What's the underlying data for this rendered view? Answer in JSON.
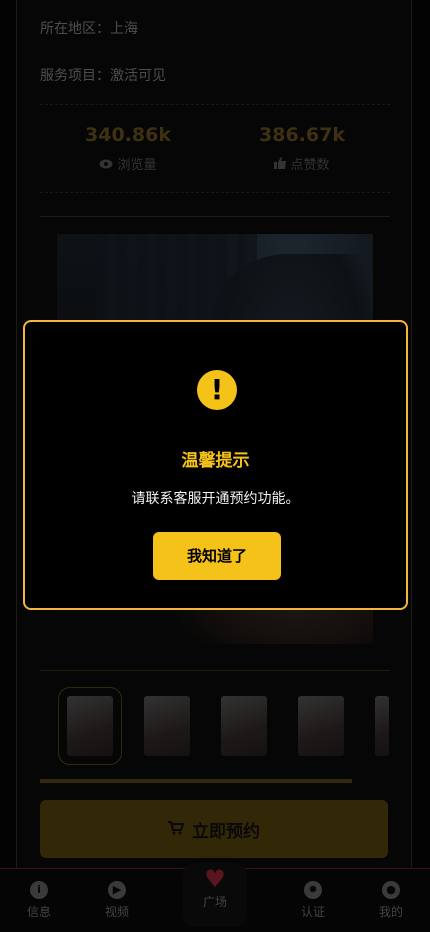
{
  "info": {
    "region_label": "所在地区：",
    "region_value": "上海",
    "service_label": "服务项目：",
    "service_value": "激活可见"
  },
  "stats": {
    "views_value": "340.86k",
    "views_label": "浏览量",
    "likes_value": "386.67k",
    "likes_label": "点赞数"
  },
  "booking": {
    "button_label": "立即预约"
  },
  "tabbar": {
    "items": [
      {
        "label": "信息",
        "icon": "info-icon"
      },
      {
        "label": "视频",
        "icon": "play-icon"
      },
      {
        "label": "广场",
        "icon": "heart-icon"
      },
      {
        "label": "认证",
        "icon": "badge-icon"
      },
      {
        "label": "我的",
        "icon": "user-icon"
      }
    ]
  },
  "modal": {
    "icon": "exclamation-icon",
    "title": "温馨提示",
    "message": "请联系客服开通预约功能。",
    "confirm_label": "我知道了"
  },
  "colors": {
    "accent": "#f5c21a",
    "modal_border": "#f2b638",
    "background": "#070707"
  }
}
